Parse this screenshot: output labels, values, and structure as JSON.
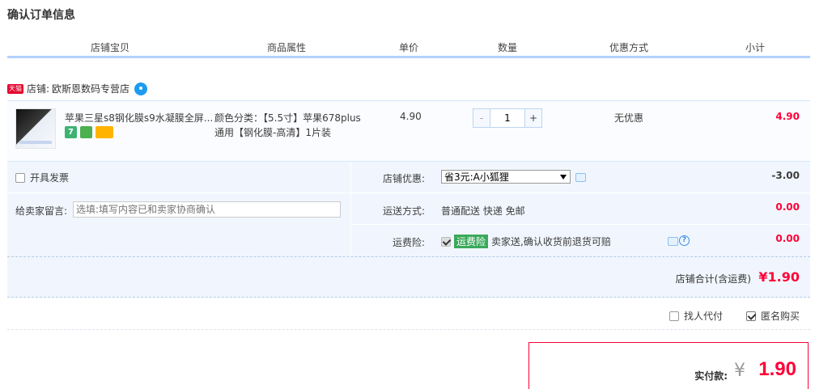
{
  "page": {
    "title": "确认订单信息"
  },
  "columns": [
    "店铺宝贝",
    "商品属性",
    "单价",
    "数量",
    "优惠方式",
    "小计"
  ],
  "shop": {
    "badge": "天猫",
    "label": "店铺:",
    "name": "欧斯恩数码专营店"
  },
  "item": {
    "title": "苹果三星s8钢化膜s9水凝膜全屏...",
    "attr_line1": "颜色分类：【5.5寸】苹果678plus",
    "attr_line2": "通用【钢化膜-高清】1片装",
    "price": "4.90",
    "quantity": "1",
    "qty_minus": "-",
    "qty_plus": "+",
    "discount": "无优惠",
    "subtotal": "4.90",
    "icon_seven": "7"
  },
  "options": {
    "invoice_label": "开具发票",
    "message_label": "给卖家留言:",
    "message_placeholder": "选填:填写内容已和卖家协商确认",
    "coupon_label": "店铺优惠:",
    "coupon_value": "省3元:A小狐狸",
    "coupon_amount": "-3.00",
    "shipping_label": "运送方式:",
    "shipping_value": "普通配送 快递 免邮",
    "shipping_amount": "0.00",
    "insurance_label": "运费险:",
    "insurance_tag": "运费险",
    "insurance_text": "卖家送,确认收货前退货可赔",
    "insurance_amount": "0.00",
    "help_glyph": "?"
  },
  "store_total": {
    "label": "店铺合计(含运费)",
    "value": "¥1.90"
  },
  "extras": {
    "proxy_pay": "找人代付",
    "anonymous": "匿名购买"
  },
  "payment": {
    "label": "实付款:",
    "currency": "¥",
    "value": "1.90"
  },
  "colors": {
    "accent_red": "#ff0036",
    "header_line": "#b2d1ff",
    "panel_bg": "#f1f6fe",
    "insurance_tag": "#3aa95a"
  }
}
